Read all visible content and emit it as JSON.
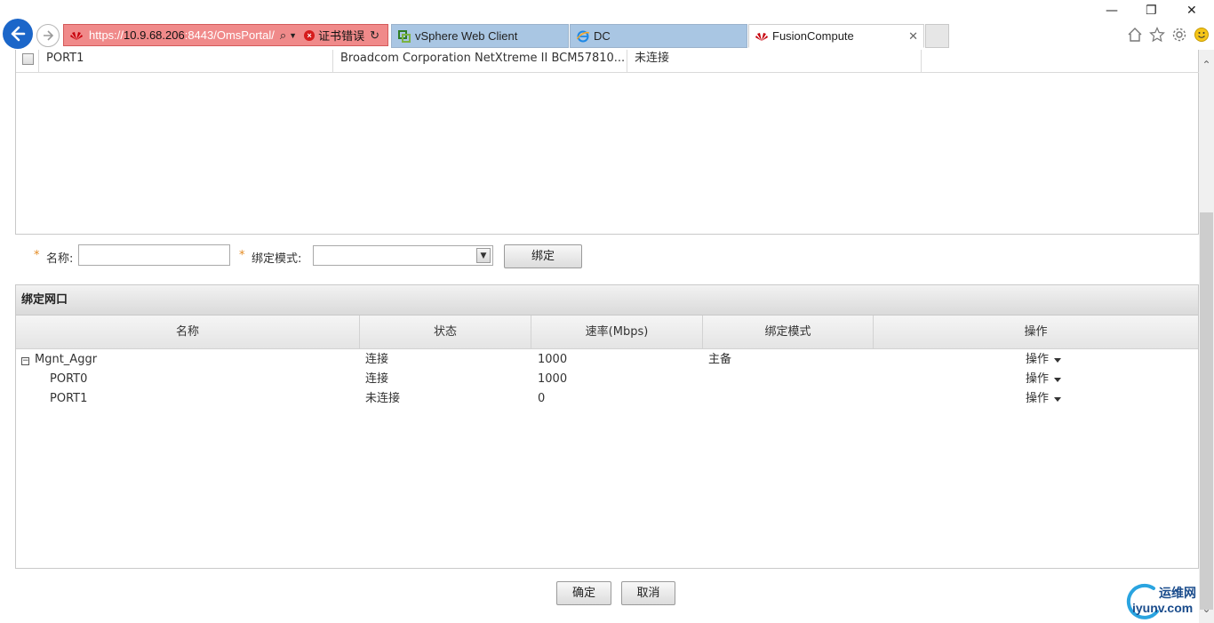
{
  "browser": {
    "address": {
      "scheme": "https://",
      "host": "10.9.68.206",
      "rest": ":8443/OmsPortal/",
      "cert_error": "证书错误"
    },
    "tabs": [
      {
        "label": "vSphere Web Client",
        "icon": "vsphere-icon"
      },
      {
        "label": "DC",
        "icon": "ie-icon"
      },
      {
        "label": "FusionCompute",
        "icon": "huawei-icon",
        "active": true
      }
    ],
    "colors": {
      "cert_error_bg": "#f08a8a",
      "tab_inactive": "#a9c6e3",
      "back_button": "#1b66c9"
    }
  },
  "top_grid": {
    "row": {
      "name": "PORT1",
      "description": "Broadcom Corporation NetXtreme II BCM57810...",
      "status": "未连接"
    }
  },
  "form": {
    "required_mark": "*",
    "name_label": "名称:",
    "mode_label": "绑定模式:",
    "name_value": "",
    "mode_value": "",
    "bind_button": "绑定"
  },
  "panel": {
    "title": "绑定网口",
    "columns": [
      "名称",
      "状态",
      "速率(Mbps)",
      "绑定模式",
      "操作"
    ],
    "rows": [
      {
        "name": "Mgnt_Aggr",
        "status": "连接",
        "speed": "1000",
        "mode": "主备",
        "action": "操作",
        "expander": "−"
      },
      {
        "name": "PORT0",
        "status": "连接",
        "speed": "1000",
        "mode": "",
        "action": "操作"
      },
      {
        "name": "PORT1",
        "status": "未连接",
        "speed": "0",
        "mode": "",
        "action": "操作"
      }
    ]
  },
  "footer": {
    "ok_button": "确定",
    "cancel_button": "取消"
  },
  "watermark": {
    "line1": "运维网",
    "line2": "iyunv.com"
  }
}
